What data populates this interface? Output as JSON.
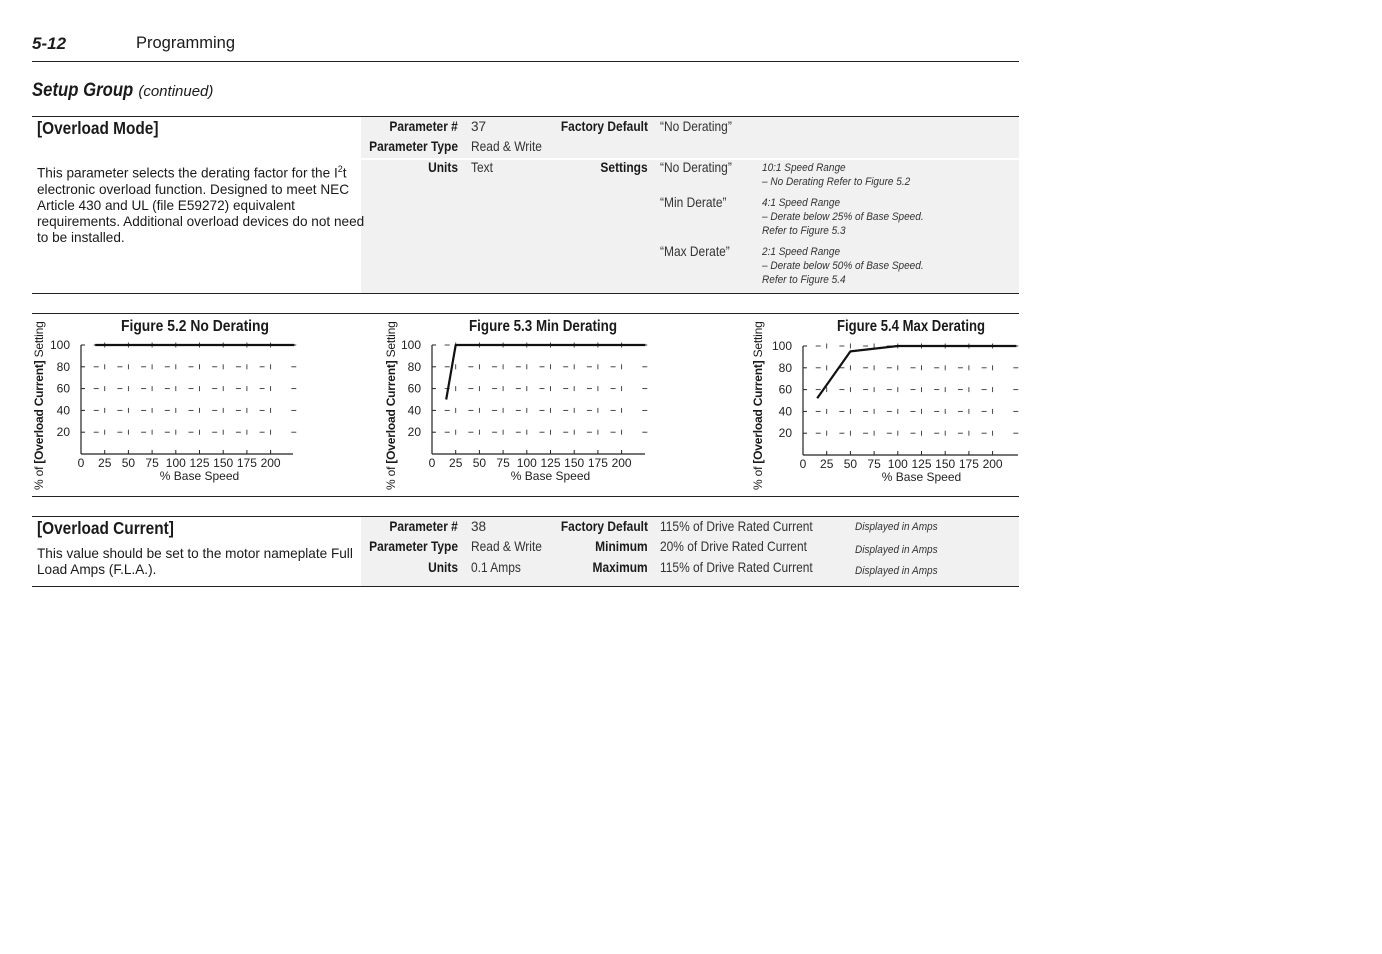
{
  "header": {
    "page_number": "5-12",
    "section": "Programming"
  },
  "group": {
    "title": "Setup Group",
    "subtitle": "(continued)"
  },
  "overload_mode": {
    "title": "[Overload Mode]",
    "description_pre": "This parameter selects the derating factor for the I",
    "description_sup": "2",
    "description_post": "t electronic overload function. Designed to meet NEC Article 430 and UL (file E59272) equivalent requirements. Additional overload devices do not need to be installed.",
    "param_num_label": "Parameter #",
    "param_num": "37",
    "param_type_label": "Parameter Type",
    "param_type": "Read & Write",
    "units_label": "Units",
    "units": "Text",
    "factory_default_label": "Factory Default",
    "factory_default": "“No Derating”",
    "settings_label": "Settings",
    "settings": [
      {
        "value": "“No Derating”",
        "notes": [
          "10:1 Speed Range",
          "– No Derating  Refer to Figure 5.2"
        ]
      },
      {
        "value": "“Min Derate”",
        "notes": [
          "4:1 Speed Range",
          "– Derate below 25% of Base Speed.",
          "Refer to Figure 5.3"
        ]
      },
      {
        "value": "“Max Derate”",
        "notes": [
          "2:1 Speed Range",
          "– Derate below 50% of Base Speed.",
          "Refer  to Figure 5.4"
        ]
      }
    ]
  },
  "figures": {
    "ylabel_pre": "% of",
    "ylabel_bold": "[Overload Current]",
    "ylabel_post": "Setting",
    "xlabel": "% Base Speed"
  },
  "chart_data": [
    {
      "type": "line",
      "title": "Figure 5.2  No Derating",
      "xlabel": "% Base Speed",
      "ylabel": "% of [Overload Current] Setting",
      "x_ticks": [
        0,
        25,
        50,
        75,
        100,
        125,
        150,
        175,
        200
      ],
      "y_ticks": [
        20,
        40,
        60,
        80,
        100
      ],
      "xlim": [
        0,
        225
      ],
      "ylim": [
        0,
        100
      ],
      "grid": true,
      "series": [
        {
          "name": "No Derating",
          "x": [
            15,
            225
          ],
          "y": [
            100,
            100
          ]
        }
      ]
    },
    {
      "type": "line",
      "title": "Figure 5.3  Min Derating",
      "xlabel": "% Base Speed",
      "ylabel": "% of [Overload Current] Setting",
      "x_ticks": [
        0,
        25,
        50,
        75,
        100,
        125,
        150,
        175,
        200
      ],
      "y_ticks": [
        20,
        40,
        60,
        80,
        100
      ],
      "xlim": [
        0,
        225
      ],
      "ylim": [
        0,
        100
      ],
      "grid": true,
      "series": [
        {
          "name": "Min Derating",
          "x": [
            15,
            25,
            225
          ],
          "y": [
            50,
            100,
            100
          ]
        }
      ]
    },
    {
      "type": "line",
      "title": "Figure 5.4  Max Derating",
      "xlabel": "% Base Speed",
      "ylabel": "% of [Overload Current] Setting",
      "x_ticks": [
        0,
        25,
        50,
        75,
        100,
        125,
        150,
        175,
        200
      ],
      "y_ticks": [
        20,
        40,
        60,
        80,
        100
      ],
      "xlim": [
        0,
        225
      ],
      "ylim": [
        0,
        100
      ],
      "grid": true,
      "series": [
        {
          "name": "Max Derating",
          "x": [
            15,
            50,
            100,
            225
          ],
          "y": [
            52,
            95,
            100,
            100
          ]
        }
      ]
    }
  ],
  "overload_current": {
    "title": "[Overload Current]",
    "description": "This value should be set to the motor nameplate Full Load Amps (F.L.A.).",
    "param_num_label": "Parameter #",
    "param_num": "38",
    "param_type_label": "Parameter Type",
    "param_type": "Read & Write",
    "units_label": "Units",
    "units": "0.1 Amps",
    "factory_default_label": "Factory Default",
    "factory_default": "115% of Drive Rated Current",
    "factory_default_note": "Displayed in Amps",
    "minimum_label": "Minimum",
    "minimum": "20% of Drive Rated Current",
    "minimum_note": "Displayed in Amps",
    "maximum_label": "Maximum",
    "maximum": "115% of Drive Rated Current",
    "maximum_note": "Displayed in Amps"
  }
}
